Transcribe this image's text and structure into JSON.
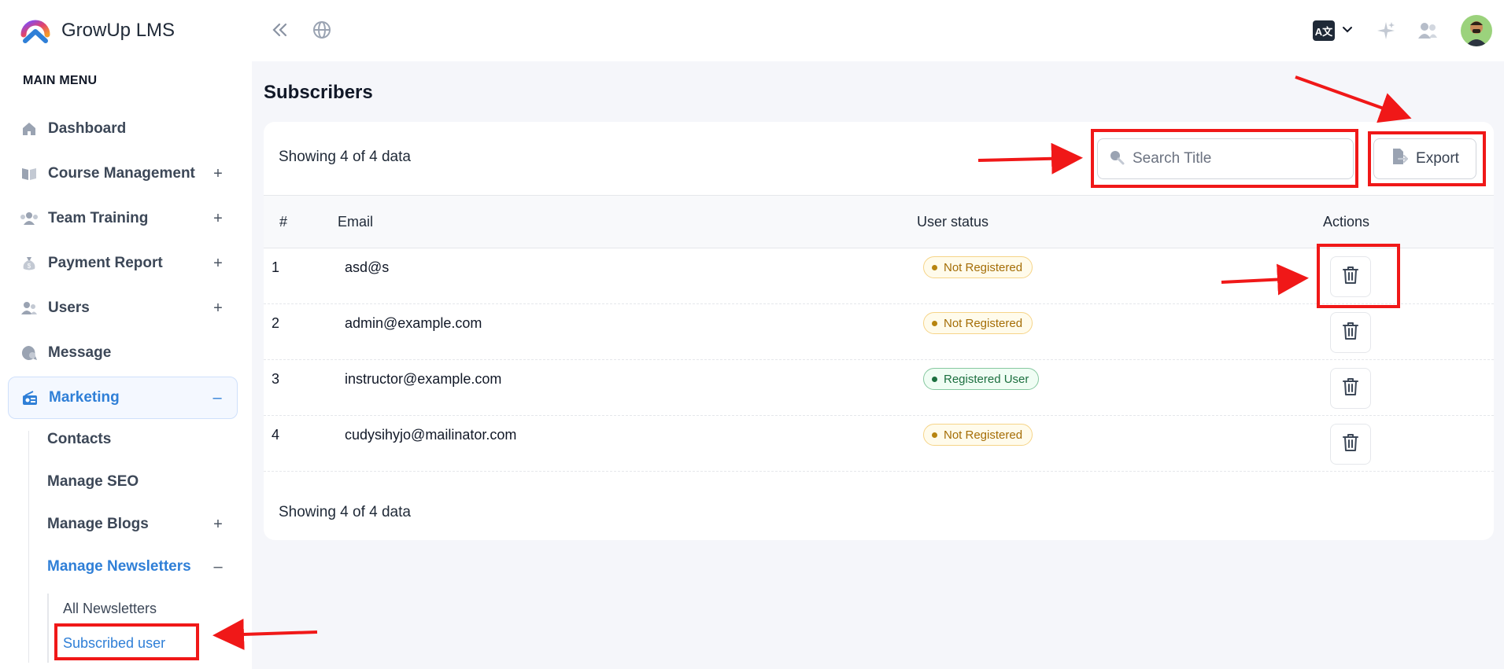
{
  "app": {
    "name": "GrowUp LMS"
  },
  "sidebar": {
    "heading": "MAIN MENU",
    "items": [
      {
        "label": "Dashboard",
        "icon": "home-icon",
        "toggle": ""
      },
      {
        "label": "Course Management",
        "icon": "book-icon",
        "toggle": "+"
      },
      {
        "label": "Team Training",
        "icon": "team-icon",
        "toggle": "+"
      },
      {
        "label": "Payment Report",
        "icon": "money-bag-icon",
        "toggle": "+"
      },
      {
        "label": "Users",
        "icon": "users-icon",
        "toggle": "+"
      },
      {
        "label": "Message",
        "icon": "chat-icon",
        "toggle": ""
      },
      {
        "label": "Marketing",
        "icon": "radio-icon",
        "toggle": "–"
      }
    ],
    "marketing_sub": [
      {
        "label": "Contacts",
        "toggle": ""
      },
      {
        "label": "Manage SEO",
        "toggle": ""
      },
      {
        "label": "Manage Blogs",
        "toggle": "+"
      },
      {
        "label": "Manage Newsletters",
        "toggle": "–"
      }
    ],
    "newsletters_sub": [
      {
        "label": "All Newsletters"
      },
      {
        "label": "Subscribed user"
      }
    ]
  },
  "topbar": {
    "language_badge": "A文",
    "icons": [
      "collapse-sidebar-icon",
      "globe-icon",
      "language-icon",
      "chevron-down-icon",
      "sparkle-icon",
      "people-icon",
      "avatar"
    ]
  },
  "page": {
    "title": "Subscribers",
    "showing_top": "Showing 4 of 4 data",
    "showing_bottom": "Showing 4 of 4 data",
    "search_placeholder": "Search Title",
    "export_label": "Export",
    "columns": [
      "#",
      "Email",
      "User status",
      "Actions"
    ],
    "rows": [
      {
        "num": "1",
        "email": "asd@s",
        "status": "Not Registered",
        "status_type": "warn"
      },
      {
        "num": "2",
        "email": "admin@example.com",
        "status": "Not Registered",
        "status_type": "warn"
      },
      {
        "num": "3",
        "email": "instructor@example.com",
        "status": "Registered User",
        "status_type": "ok"
      },
      {
        "num": "4",
        "email": "cudysihyjo@mailinator.com",
        "status": "Not Registered",
        "status_type": "warn"
      }
    ]
  },
  "colors": {
    "accent": "#2f7fd7",
    "annotation": "#f01818",
    "warn": "#a46d06",
    "ok": "#1c6f3f"
  }
}
